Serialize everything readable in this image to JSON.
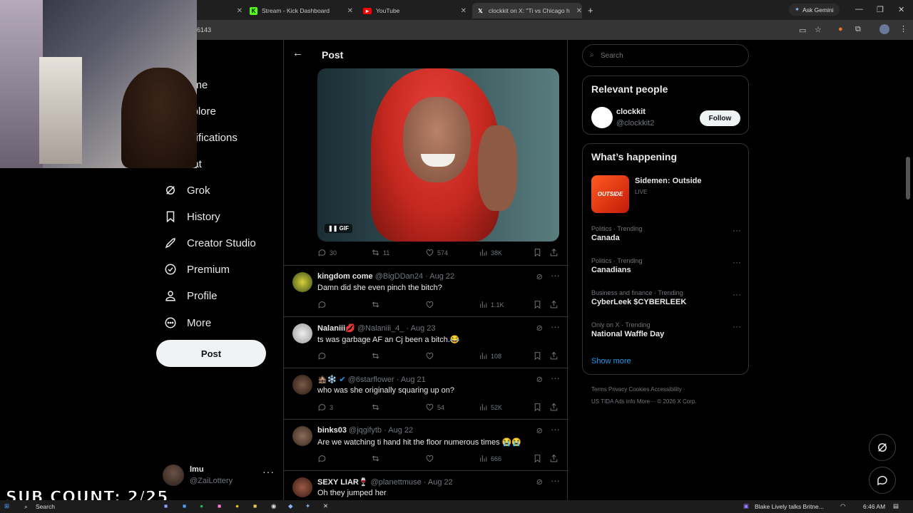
{
  "browser": {
    "tabs": [
      {
        "label": "Stream - Kick Dashboard"
      },
      {
        "label": "YouTube"
      },
      {
        "label": "clockkit on X: \"Ti vs Chicago h"
      }
    ],
    "ask_gemini": "Ask Gemini",
    "address_fragment": "6143"
  },
  "nav": {
    "items": [
      {
        "label": "ome"
      },
      {
        "label": "xplore"
      },
      {
        "label": "otifications"
      },
      {
        "label": "hat"
      },
      {
        "label": "Grok"
      },
      {
        "label": "History"
      },
      {
        "label": "Creator Studio"
      },
      {
        "label": "Premium"
      },
      {
        "label": "Profile"
      },
      {
        "label": "More"
      }
    ],
    "post_button": "Post",
    "account": {
      "name": "lmu",
      "handle": "@ZaiLottery",
      "more": "···"
    }
  },
  "main": {
    "title": "Post",
    "gif_label": "GIF",
    "post_actions": {
      "replies": "30",
      "reposts": "11",
      "likes": "574",
      "views": "38K"
    },
    "replies": [
      {
        "name": "kingdom come",
        "handle": "@BigDDan24",
        "date": "Aug 22",
        "text": "Damn did she even pinch the bitch?",
        "replies": "",
        "reposts": "",
        "likes": "",
        "views": "1.1K"
      },
      {
        "name": "Nalaniii💋",
        "handle": "@Nalaniii_4_",
        "date": "Aug 23",
        "text": "ts was garbage AF an Cj been a bitch.😂",
        "replies": "",
        "reposts": "",
        "likes": "",
        "views": "108"
      },
      {
        "name": "🏚️❄️",
        "handle": "@6starflower",
        "date": "Aug 21",
        "text": "who was she originally squaring up on?",
        "replies": "3",
        "reposts": "",
        "likes": "54",
        "views": "52K"
      },
      {
        "name": "binks03",
        "handle": "@jqgifytb",
        "date": "Aug 22",
        "text": "Are we watching ti hand hit the floor numerous times 😭😭",
        "replies": "",
        "reposts": "",
        "likes": "",
        "views": "666"
      },
      {
        "name": "SEXY LIAR🍷",
        "handle": "@planettmuse",
        "date": "Aug 22",
        "text": "Oh they jumped her",
        "replies": "",
        "reposts": "",
        "likes": "",
        "views": ""
      }
    ]
  },
  "sidebar_right": {
    "search_placeholder": "Search",
    "relevant_title": "Relevant people",
    "person": {
      "name": "clockkit",
      "handle": "@clockkit2",
      "follow": "Follow"
    },
    "happening_title": "What’s happening",
    "live_event": {
      "title": "Sidemen: Outside",
      "status": "LIVE",
      "thumb_text": "OUTSIDE"
    },
    "trends": [
      {
        "context": "Politics · Trending",
        "topic": "Canada"
      },
      {
        "context": "Politics · Trending",
        "topic": "Canadians"
      },
      {
        "context": "Business and finance · Trending",
        "topic": "CyberLeek $CYBERLEEK"
      },
      {
        "context": "Only on X · Trending",
        "topic": "National Waffle Day"
      }
    ],
    "show_more": "Show more",
    "footer_line1": "Terms   Privacy   Cookies   Accessibility  ·",
    "footer_line2": "US TIDA   Ads info   More···   © 2026 X Corp."
  },
  "overlay": {
    "sub_count": "SUB COUNT: 2/25"
  },
  "taskbar": {
    "search": "Search",
    "news": "Blake Lively talks Britne...",
    "time": "6:46 AM"
  },
  "colors": {
    "background": "#000000",
    "border": "#2f3336",
    "muted": "#71767b",
    "text": "#e7e9ea",
    "accent": "#1d9bf0"
  }
}
